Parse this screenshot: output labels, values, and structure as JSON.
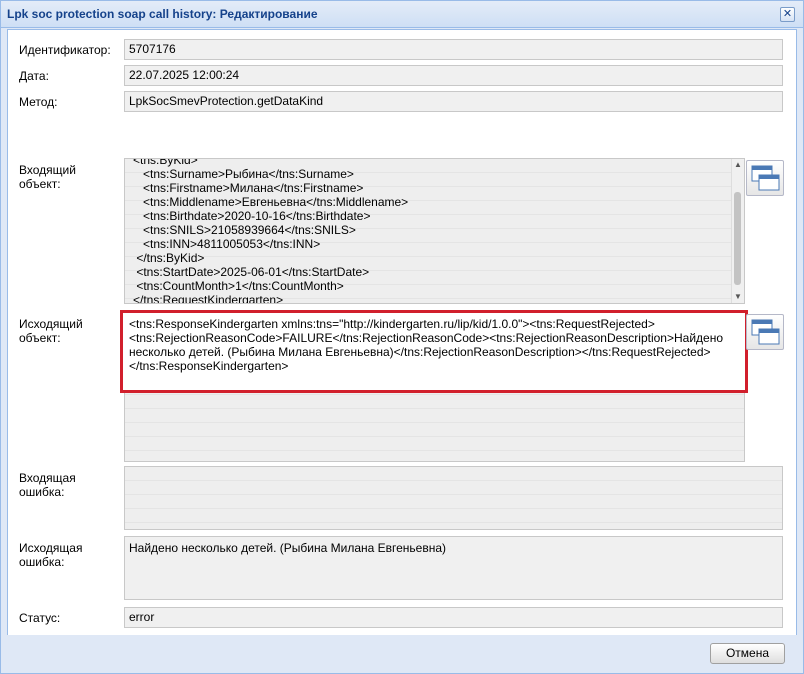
{
  "window": {
    "title": "Lpk soc protection soap call history: Редактирование"
  },
  "fields": {
    "id": {
      "label": "Идентификатор:",
      "value": "5707176"
    },
    "date": {
      "label": "Дата:",
      "value": "22.07.2025 12:00:24"
    },
    "method": {
      "label": "Метод:",
      "value": "LpkSocSmevProtection.getDataKind"
    },
    "incoming_object": {
      "label_line1": "Входящий",
      "label_line2": "объект:",
      "lines": [
        "<tns:ByKid>",
        "   <tns:Surname>Рыбина</tns:Surname>",
        "   <tns:Firstname>Милана</tns:Firstname>",
        "   <tns:Middlename>Евгеньевна</tns:Middlename>",
        "   <tns:Birthdate>2020-10-16</tns:Birthdate>",
        "   <tns:SNILS>21058939664</tns:SNILS>",
        "   <tns:INN>4811005053</tns:INN>",
        " </tns:ByKid>",
        " <tns:StartDate>2025-06-01</tns:StartDate>",
        " <tns:CountMonth>1</tns:CountMonth>",
        "</tns:RequestKindergarten>"
      ]
    },
    "outgoing_object": {
      "label_line1": "Исходящий",
      "label_line2": "объект:",
      "value": "<tns:ResponseKindergarten xmlns:tns=\"http://kindergarten.ru/lip/kid/1.0.0\"><tns:RequestRejected><tns:RejectionReasonCode>FAILURE</tns:RejectionReasonCode><tns:RejectionReasonDescription>Найдено несколько детей. (Рыбина Милана Евгеньевна)</tns:RejectionReasonDescription></tns:RequestRejected></tns:ResponseKindergarten>"
    },
    "incoming_error": {
      "label_line1": "Входящая",
      "label_line2": "ошибка:",
      "value": ""
    },
    "outgoing_error": {
      "label_line1": "Исходящая",
      "label_line2": "ошибка:",
      "value": "Найдено несколько детей. (Рыбина Милана Евгеньевна)"
    },
    "status": {
      "label": "Статус:",
      "value": "error"
    }
  },
  "buttons": {
    "cancel": "Отмена"
  },
  "icons": {
    "popup": "open-window-icon",
    "close": "close-icon"
  },
  "colors": {
    "highlight_border": "#d11f2c",
    "title_text": "#15428b"
  }
}
